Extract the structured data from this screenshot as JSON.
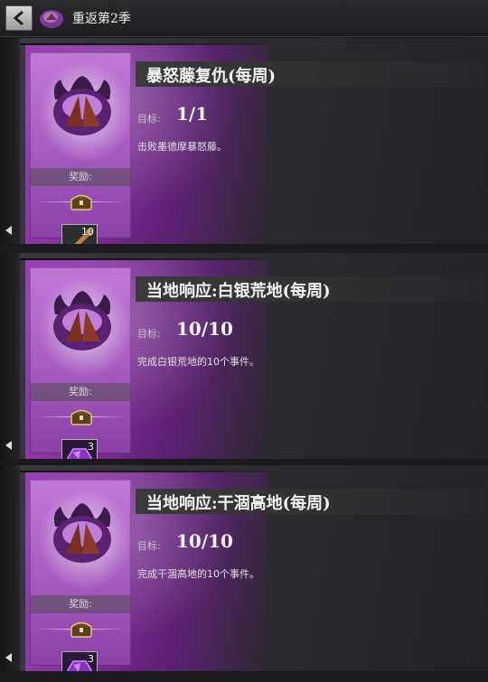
{
  "header": {
    "back_icon": "back-arrow-icon",
    "season_icon": "season-emblem-icon",
    "title": "重返第2季"
  },
  "colors": {
    "panel_purple": "#a55ac0",
    "card_bg": "#2c2b30"
  },
  "cards": [
    {
      "title": "暴怒藤复仇(每周)",
      "goal_label": "目标:",
      "progress": "1/1",
      "description": "击败墨德摩暴怒藤。",
      "reward_label": "奖励:",
      "reward_icon": "reward-chest-icon",
      "item_icon": "torch-item-icon",
      "item_count": "10"
    },
    {
      "title": "当地响应:白银荒地(每周)",
      "goal_label": "目标:",
      "progress": "10/10",
      "description": "完成白银荒地的10个事件。",
      "reward_label": "奖励:",
      "reward_icon": "reward-chest-icon",
      "item_icon": "purple-potion-icon",
      "item_count": "3"
    },
    {
      "title": "当地响应:干涸高地(每周)",
      "goal_label": "目标:",
      "progress": "10/10",
      "description": "完成干涸高地的10个事件。",
      "reward_label": "奖励:",
      "reward_icon": "reward-chest-icon",
      "item_icon": "purple-potion-icon",
      "item_count": "3"
    }
  ]
}
